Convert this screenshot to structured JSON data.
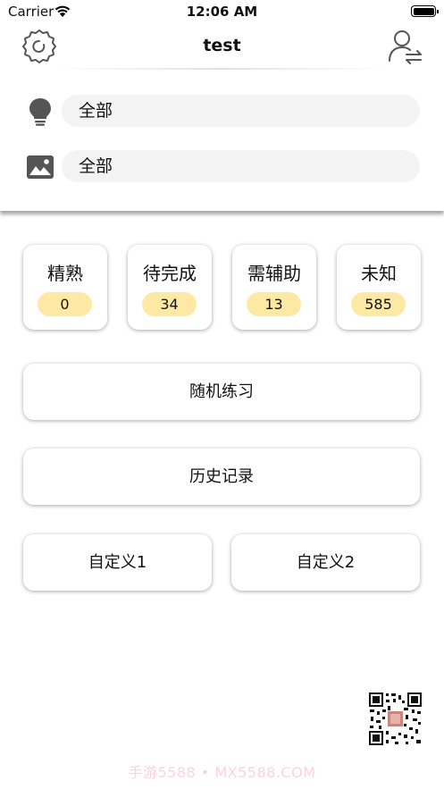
{
  "status_bar": {
    "carrier": "Carrier",
    "time": "12:06 AM"
  },
  "nav": {
    "title": "test",
    "left_icon": "gear-icon",
    "right_icon": "user-switch-icon"
  },
  "filters": [
    {
      "icon": "lightbulb-icon",
      "value": "全部"
    },
    {
      "icon": "image-icon",
      "value": "全部"
    }
  ],
  "stats": [
    {
      "label": "精熟",
      "count": "0"
    },
    {
      "label": "待完成",
      "count": "34"
    },
    {
      "label": "需辅助",
      "count": "13"
    },
    {
      "label": "未知",
      "count": "585"
    }
  ],
  "actions": {
    "random_practice": "随机练习",
    "history": "历史记录",
    "custom1": "自定义1",
    "custom2": "自定义2"
  },
  "watermark": "手游5588 • MX5588.COM",
  "colors": {
    "badge": "#fde9a4",
    "field": "#f3f3f3",
    "icon": "#555555"
  }
}
